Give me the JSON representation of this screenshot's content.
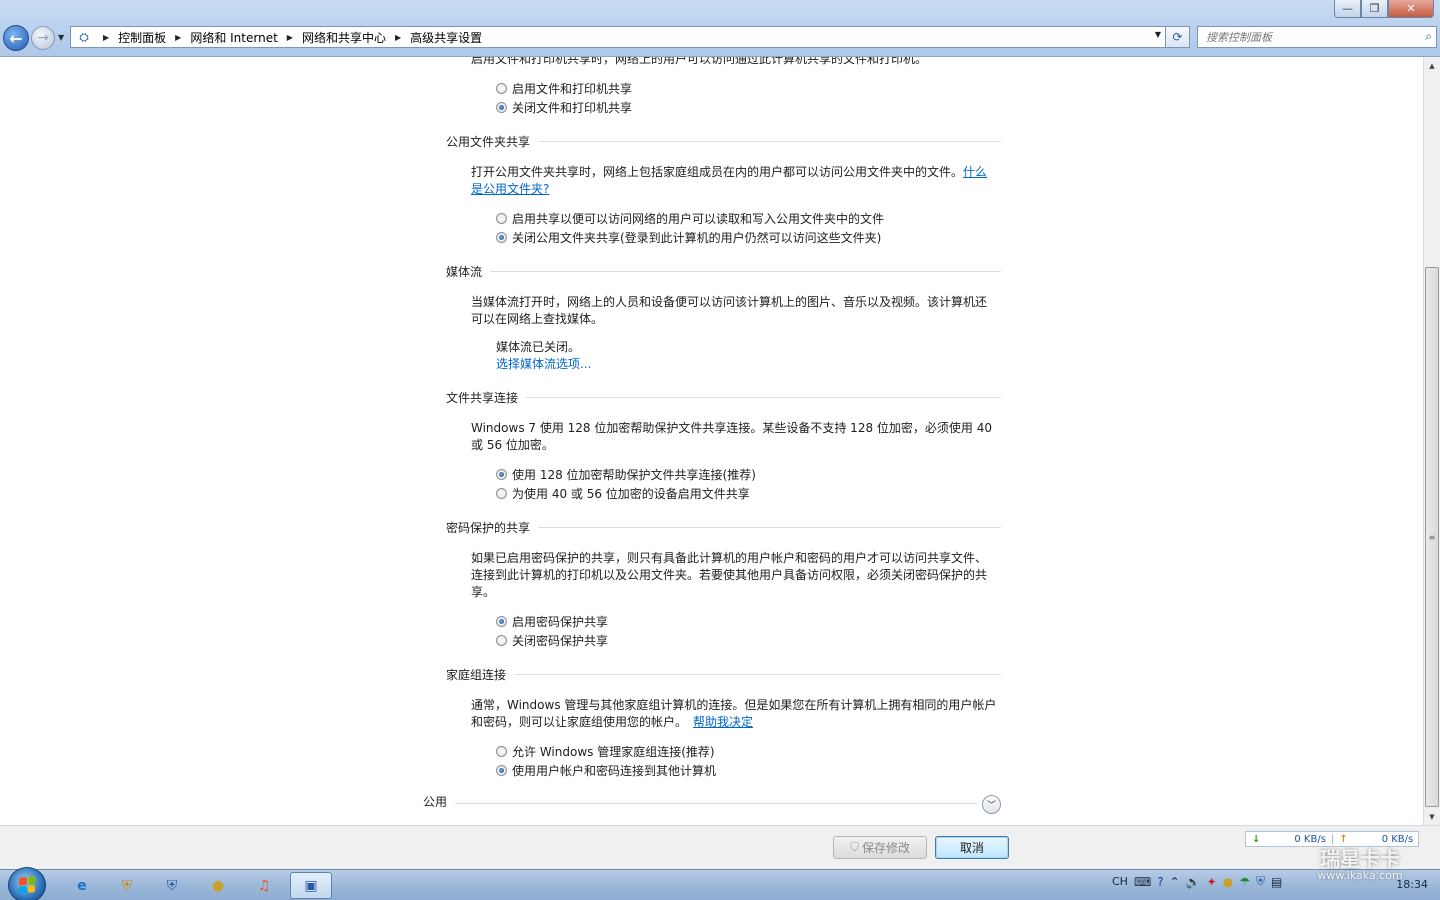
{
  "window": {
    "buttons": {
      "minimize": "—",
      "maximize": "❐",
      "close": "✕"
    }
  },
  "nav": {
    "back_glyph": "←",
    "forward_glyph": "→",
    "breadcrumb": [
      "控制面板",
      "网络和 Internet",
      "网络和共享中心",
      "高级共享设置"
    ],
    "search_placeholder": "搜索控制面板"
  },
  "sections": {
    "printer": {
      "desc_partial": "启用文件和打印机共享时，网络上的用户可以访问通过此计算机共享的文件和打印机。",
      "options": [
        "启用文件和打印机共享",
        "关闭文件和打印机共享"
      ],
      "selected": 1
    },
    "public_folder": {
      "title": "公用文件夹共享",
      "desc": "打开公用文件夹共享时，网络上包括家庭组成员在内的用户都可以访问公用文件夹中的文件。",
      "link_part1": "什么",
      "link_part2": "是公用文件夹?",
      "options": [
        "启用共享以便可以访问网络的用户可以读取和写入公用文件夹中的文件",
        "关闭公用文件夹共享(登录到此计算机的用户仍然可以访问这些文件夹)"
      ],
      "selected": 1
    },
    "media": {
      "title": "媒体流",
      "desc_line1": "当媒体流打开时，网络上的人员和设备便可以访问该计算机上的图片、音乐以及视频。该计算机还",
      "desc_line2": "可以在网络上查找媒体。",
      "status": "媒体流已关闭。",
      "link": "选择媒体流选项..."
    },
    "file_sharing": {
      "title": "文件共享连接",
      "desc_line1": "Windows 7 使用 128 位加密帮助保护文件共享连接。某些设备不支持 128 位加密，必须使用 40",
      "desc_line2": "或 56 位加密。",
      "options": [
        "使用 128 位加密帮助保护文件共享连接(推荐)",
        "为使用 40 或 56 位加密的设备启用文件共享"
      ],
      "selected": 0
    },
    "password": {
      "title": "密码保护的共享",
      "desc_line1": "如果已启用密码保护的共享，则只有具备此计算机的用户帐户和密码的用户才可以访问共享文件、",
      "desc_line2": "连接到此计算机的打印机以及公用文件夹。若要使其他用户具备访问权限，必须关闭密码保护的共",
      "desc_line3": "享。",
      "options": [
        "启用密码保护共享",
        "关闭密码保护共享"
      ],
      "selected": 0
    },
    "homegroup": {
      "title": "家庭组连接",
      "desc_line1": "通常，Windows 管理与其他家庭组计算机的连接。但是如果您在所有计算机上拥有相同的用户帐户",
      "desc_line2": "和密码，则可以让家庭组使用您的帐户。",
      "link": "帮助我决定",
      "options": [
        "允许 Windows 管理家庭组连接(推荐)",
        "使用用户帐户和密码连接到其他计算机"
      ],
      "selected": 1
    },
    "public_profile": {
      "title": "公用"
    }
  },
  "commands": {
    "save": "保存修改",
    "cancel": "取消"
  },
  "netspeed": {
    "down": "0 KB/s",
    "up": "0 KB/s"
  },
  "tray": {
    "lang": "CH",
    "time": "18:34"
  },
  "watermark": {
    "brand": "瑞星卡卡",
    "url": "www.ikaka.com"
  },
  "colors": {
    "link": "#0066cc",
    "titlebar": "#b7cfee",
    "taskbar": "#9cb8da"
  }
}
